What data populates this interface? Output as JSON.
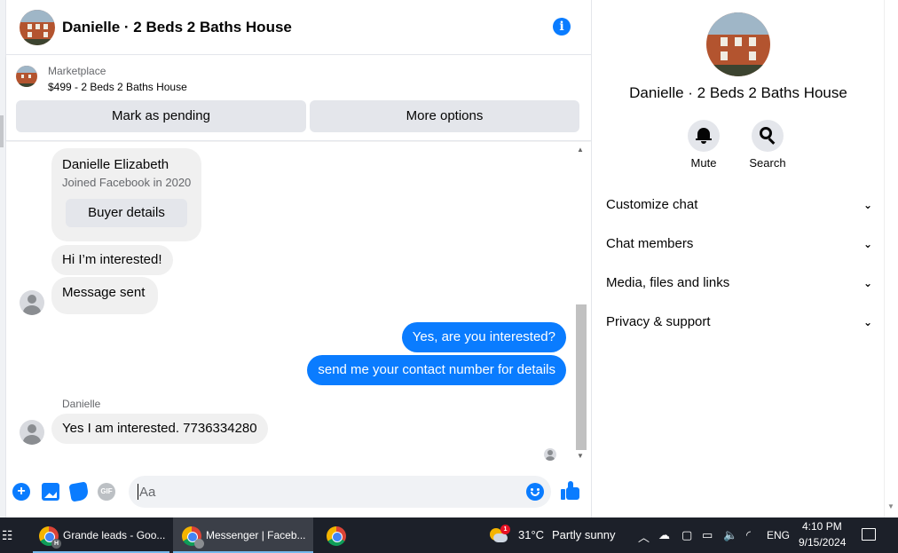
{
  "header": {
    "title": "Danielle · 2 Beds 2 Baths House",
    "info_icon": "info-icon"
  },
  "marketplace": {
    "label": "Marketplace",
    "listing": "$499 - 2 Beds 2 Baths House",
    "mark_pending": "Mark as pending",
    "more_options": "More options"
  },
  "messages": {
    "profile_card": {
      "name": "Danielle Elizabeth",
      "joined": "Joined Facebook in 2020",
      "buyer_details": "Buyer details"
    },
    "msg1": "Hi I’m interested!",
    "msg2": "Message sent",
    "msg3": "Yes, are you interested?",
    "msg4": "send me your contact number for details",
    "sender_label": "Danielle",
    "msg5": "Yes I am interested. 7736334280"
  },
  "composer": {
    "placeholder": "Aa",
    "gif_label": "GIF"
  },
  "right_panel": {
    "title": "Danielle · 2 Beds 2 Baths House",
    "mute": "Mute",
    "search": "Search",
    "menu": [
      {
        "label": "Customize chat"
      },
      {
        "label": "Chat members"
      },
      {
        "label": "Media, files and links"
      },
      {
        "label": "Privacy & support"
      }
    ]
  },
  "taskbar": {
    "tasks": [
      {
        "label": "Grande leads - Goo..."
      },
      {
        "label": "Messenger | Faceb..."
      }
    ],
    "weather_temp": "31°C",
    "weather_desc": "Partly sunny",
    "weather_badge": "1",
    "lang": "ENG",
    "time": "4:10 PM",
    "date": "9/15/2024",
    "profile_h": "H"
  },
  "colors": {
    "accent": "#0a7cff",
    "bubble_grey": "#f0f0f0",
    "taskbar": "#1c2029"
  }
}
